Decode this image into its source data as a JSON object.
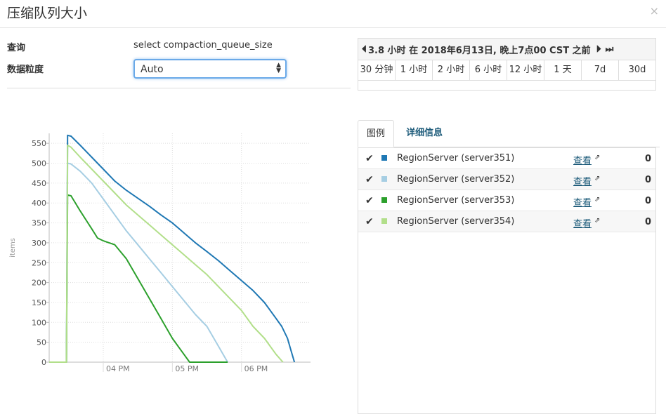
{
  "dialog": {
    "title": "压缩队列大小",
    "close": "×"
  },
  "form": {
    "query_label": "查询",
    "query_value": "select compaction_queue_size",
    "granularity_label": "数据粒度",
    "granularity_value": "Auto"
  },
  "time_range": {
    "prev": "⏴⏴",
    "label": "3.8 小时 在 2018年6月13日, 晚上7点00 CST 之前",
    "next": "⏵⏵",
    "last": "⏭",
    "options": [
      "30 分钟",
      "1 小时",
      "2 小时",
      "6 小时",
      "12 小时",
      "1 天",
      "7d",
      "30d"
    ]
  },
  "tabs": {
    "legend": "图例",
    "details": "详细信息"
  },
  "legend": [
    {
      "check": "✔",
      "name": "RegionServer (server351)",
      "color": "#1f78b4",
      "link": "查看",
      "value": "0"
    },
    {
      "check": "✔",
      "name": "RegionServer (server352)",
      "color": "#a6cee3",
      "link": "查看",
      "value": "0"
    },
    {
      "check": "✔",
      "name": "RegionServer (server353)",
      "color": "#2ca02c",
      "link": "查看",
      "value": "0"
    },
    {
      "check": "✔",
      "name": "RegionServer (server354)",
      "color": "#b2df8a",
      "link": "查看",
      "value": "0"
    }
  ],
  "chart_data": {
    "type": "line",
    "ylabel": "items",
    "ylim": [
      0,
      575
    ],
    "yticks": [
      0,
      50,
      100,
      150,
      200,
      250,
      300,
      350,
      400,
      450,
      500,
      550
    ],
    "xlim": [
      "15:13",
      "19:00"
    ],
    "xticks": [
      {
        "label": "04 PM",
        "t": "16:00"
      },
      {
        "label": "05 PM",
        "t": "17:00"
      },
      {
        "label": "06 PM",
        "t": "18:00"
      }
    ],
    "grid": true,
    "series": [
      {
        "name": "RegionServer (server351)",
        "color": "#1f78b4",
        "points": [
          [
            "15:13",
            0
          ],
          [
            "15:28",
            0
          ],
          [
            "15:29",
            570
          ],
          [
            "15:32",
            568
          ],
          [
            "15:40",
            545
          ],
          [
            "15:50",
            515
          ],
          [
            "16:00",
            485
          ],
          [
            "16:10",
            455
          ],
          [
            "16:20",
            432
          ],
          [
            "16:30",
            412
          ],
          [
            "16:40",
            392
          ],
          [
            "16:50",
            370
          ],
          [
            "17:00",
            350
          ],
          [
            "17:10",
            325
          ],
          [
            "17:20",
            300
          ],
          [
            "17:30",
            278
          ],
          [
            "17:40",
            255
          ],
          [
            "17:50",
            230
          ],
          [
            "18:00",
            205
          ],
          [
            "18:10",
            180
          ],
          [
            "18:20",
            150
          ],
          [
            "18:30",
            110
          ],
          [
            "18:35",
            90
          ],
          [
            "18:40",
            60
          ],
          [
            "18:43",
            30
          ],
          [
            "18:46",
            0
          ]
        ]
      },
      {
        "name": "RegionServer (server352)",
        "color": "#a6cee3",
        "points": [
          [
            "15:13",
            0
          ],
          [
            "15:28",
            0
          ],
          [
            "15:29",
            500
          ],
          [
            "15:32",
            498
          ],
          [
            "15:40",
            480
          ],
          [
            "15:50",
            450
          ],
          [
            "16:00",
            410
          ],
          [
            "16:10",
            370
          ],
          [
            "16:20",
            330
          ],
          [
            "16:30",
            295
          ],
          [
            "16:40",
            260
          ],
          [
            "16:50",
            225
          ],
          [
            "17:00",
            190
          ],
          [
            "17:10",
            155
          ],
          [
            "17:20",
            120
          ],
          [
            "17:30",
            90
          ],
          [
            "17:40",
            40
          ],
          [
            "17:45",
            15
          ],
          [
            "17:48",
            0
          ]
        ]
      },
      {
        "name": "RegionServer (server353)",
        "color": "#2ca02c",
        "points": [
          [
            "15:13",
            0
          ],
          [
            "15:28",
            0
          ],
          [
            "15:29",
            420
          ],
          [
            "15:32",
            418
          ],
          [
            "15:40",
            380
          ],
          [
            "15:50",
            335
          ],
          [
            "15:55",
            312
          ],
          [
            "16:00",
            305
          ],
          [
            "16:05",
            300
          ],
          [
            "16:10",
            295
          ],
          [
            "16:20",
            260
          ],
          [
            "16:30",
            210
          ],
          [
            "16:40",
            160
          ],
          [
            "16:50",
            110
          ],
          [
            "17:00",
            60
          ],
          [
            "17:10",
            20
          ],
          [
            "17:15",
            0
          ],
          [
            "17:48",
            0
          ]
        ]
      },
      {
        "name": "RegionServer (server354)",
        "color": "#b2df8a",
        "points": [
          [
            "15:13",
            0
          ],
          [
            "15:28",
            0
          ],
          [
            "15:29",
            545
          ],
          [
            "15:32",
            540
          ],
          [
            "15:40",
            515
          ],
          [
            "15:50",
            485
          ],
          [
            "16:00",
            455
          ],
          [
            "16:10",
            425
          ],
          [
            "16:20",
            395
          ],
          [
            "16:30",
            370
          ],
          [
            "16:40",
            345
          ],
          [
            "16:50",
            320
          ],
          [
            "17:00",
            295
          ],
          [
            "17:10",
            270
          ],
          [
            "17:20",
            245
          ],
          [
            "17:30",
            220
          ],
          [
            "17:40",
            190
          ],
          [
            "17:50",
            160
          ],
          [
            "18:00",
            130
          ],
          [
            "18:10",
            90
          ],
          [
            "18:20",
            60
          ],
          [
            "18:30",
            20
          ],
          [
            "18:36",
            0
          ]
        ]
      }
    ]
  }
}
